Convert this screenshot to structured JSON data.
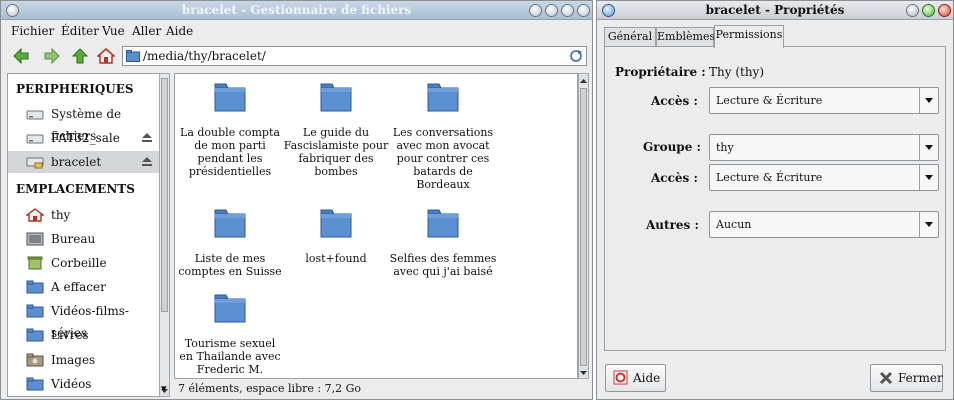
{
  "file_manager": {
    "title": "bracelet - Gestionnaire de fichiers",
    "menu": [
      "Fichier",
      "Éditer",
      "Vue",
      "Aller",
      "Aide"
    ],
    "path": "/media/thy/bracelet/",
    "sidebar": {
      "devices_heading": "PERIPHERIQUES",
      "devices": [
        {
          "label": "Système de fichiers",
          "icon": "drive-icon"
        },
        {
          "label": "FAT32_sale",
          "icon": "drive-icon",
          "eject": true
        },
        {
          "label": "bracelet",
          "icon": "usb-drive-icon",
          "eject": true,
          "selected": true
        }
      ],
      "places_heading": "EMPLACEMENTS",
      "places": [
        {
          "label": "thy",
          "icon": "home-icon"
        },
        {
          "label": "Bureau",
          "icon": "desktop-icon"
        },
        {
          "label": "Corbeille",
          "icon": "trash-icon"
        },
        {
          "label": "A effacer",
          "icon": "folder-icon"
        },
        {
          "label": "Vidéos-films-séries",
          "icon": "folder-icon"
        },
        {
          "label": "Livres",
          "icon": "folder-icon"
        },
        {
          "label": "Images",
          "icon": "pictures-folder-icon"
        },
        {
          "label": "Vidéos",
          "icon": "folder-icon"
        }
      ]
    },
    "files": [
      {
        "name": "La double compta de mon parti pendant les présidentielles",
        "lines": [
          "La double compta",
          "de mon parti",
          "pendant les",
          "présidentielles"
        ]
      },
      {
        "name": "Le guide du Fascislamiste pour fabriquer des bombes",
        "lines": [
          "Le guide du",
          "Fascislamiste pour",
          "fabriquer des",
          "bombes"
        ]
      },
      {
        "name": "Les conversations avec mon avocat pour contrer ces batards de Bordeaux",
        "lines": [
          "Les conversations",
          "avec mon avocat",
          "pour contrer ces",
          "batards de",
          "Bordeaux"
        ]
      },
      {
        "name": "Liste de mes comptes en Suisse",
        "lines": [
          "Liste de mes",
          "comptes en Suisse"
        ]
      },
      {
        "name": "lost+found",
        "lines": [
          "lost+found"
        ]
      },
      {
        "name": "Selfies des femmes avec qui j'ai baisé",
        "lines": [
          "Selfies des femmes",
          "avec qui j'ai baisé"
        ]
      },
      {
        "name": "Tourisme sexuel en Thailande avec Frederic M.",
        "lines": [
          "Tourisme sexuel",
          "en Thailande avec",
          "Frederic M."
        ]
      }
    ],
    "status": "7 éléments, espace libre : 7,2 Go"
  },
  "properties": {
    "title": "bracelet - Propriétés",
    "tabs": [
      "Général",
      "Emblèmes",
      "Permissions"
    ],
    "active_tab": "Permissions",
    "owner_label": "Propriétaire :",
    "owner_value": "Thy (thy)",
    "owner_access_label": "Accès :",
    "owner_access_value": "Lecture & Écriture",
    "group_label": "Groupe :",
    "group_value": "thy",
    "group_access_label": "Accès :",
    "group_access_value": "Lecture & Écriture",
    "others_label": "Autres :",
    "others_value": "Aucun",
    "help_button": "Aide",
    "close_button": "Fermer"
  },
  "colors": {
    "folder": "#5a8fd0",
    "accent": "#4a90d9"
  }
}
